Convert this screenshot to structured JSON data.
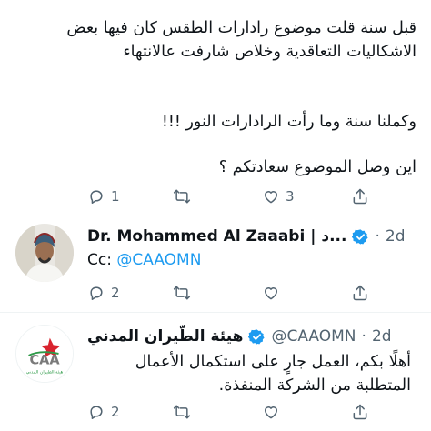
{
  "tweet1": {
    "paragraph1": "قبل سنة قلت موضوع رادارات الطقس كان فيها بعض الاشكاليات التعاقدية وخلاص شارفت عالانتهاء",
    "paragraph2": "وكملنا سنة وما رأت الرادارات النور !!!",
    "paragraph3": "اين وصل الموضوع سعادتكم ؟",
    "replies": "1",
    "retweets": "",
    "likes": "3"
  },
  "tweet2": {
    "name": "Dr. Mohammed Al Zaaabi | د...",
    "dot": "·",
    "time": "2d",
    "cc_label": "Cc:",
    "mention": "@CAAOMN",
    "replies": "2",
    "retweets": "",
    "likes": ""
  },
  "tweet3": {
    "name": "هيئة الطّيران المدني",
    "handle": "@CAAOMN",
    "dot": "·",
    "time": "2d",
    "logo_text": "CAA",
    "logo_sub": "هيئة الطيران المدني",
    "text": "أهلًا بكم، العمل جارٍ على استكمال الأعمال المتطلبة من الشركة المنفذة.",
    "replies": "2",
    "retweets": "",
    "likes": ""
  },
  "colors": {
    "text": "#0f1419",
    "secondary": "#536471",
    "accent": "#1d9bf0",
    "verified": "#1d9bf0"
  },
  "icons": [
    "reply-icon",
    "retweet-icon",
    "like-icon",
    "share-icon",
    "verified-badge-icon"
  ]
}
